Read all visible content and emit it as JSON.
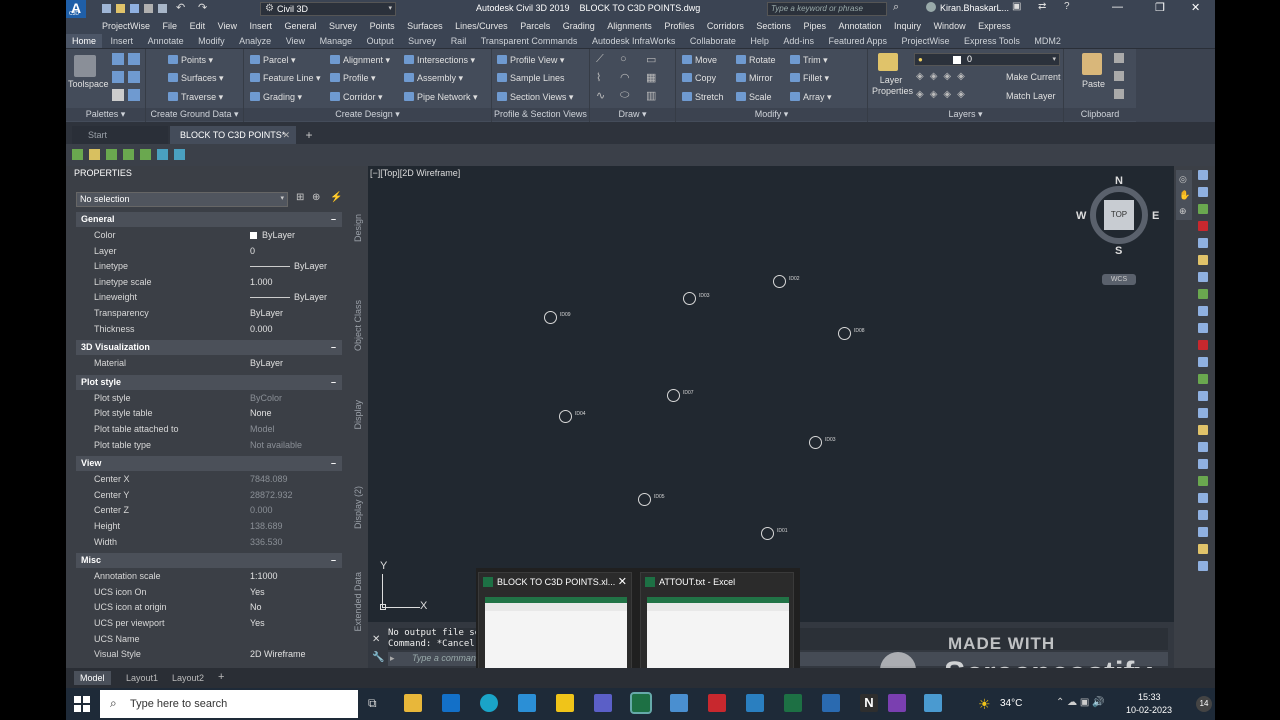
{
  "app": {
    "logo": "A",
    "logo_sub": "C3D",
    "workspace": "Civil 3D",
    "title": "Autodesk Civil 3D 2019    BLOCK TO C3D POINTS.dwg",
    "search_placeholder": "Type a keyword or phrase",
    "user": "Kiran.BhaskarL...",
    "min": "—",
    "max": "❐",
    "close": "✕"
  },
  "menu": [
    "ProjectWise",
    "File",
    "Edit",
    "View",
    "Insert",
    "General",
    "Survey",
    "Points",
    "Surfaces",
    "Lines/Curves",
    "Parcels",
    "Grading",
    "Alignments",
    "Profiles",
    "Corridors",
    "Sections",
    "Pipes",
    "Annotation",
    "Inquiry",
    "Window",
    "Express"
  ],
  "ribbon_tabs": [
    "Home",
    "Insert",
    "Annotate",
    "Modify",
    "Analyze",
    "View",
    "Manage",
    "Output",
    "Survey",
    "Rail",
    "Transparent Commands",
    "Autodesk InfraWorks",
    "Collaborate",
    "Help",
    "Add-ins",
    "Featured Apps",
    "ProjectWise",
    "Express Tools",
    "MDM2"
  ],
  "ribbon": {
    "toolspace": "Toolspace",
    "palettes": "Palettes ▾",
    "ground": [
      "Points ▾",
      "Surfaces ▾",
      "Traverse ▾"
    ],
    "ground_label": "Create Ground Data ▾",
    "design_col1": [
      "Parcel ▾",
      "Feature Line ▾",
      "Grading ▾"
    ],
    "design_col2": [
      "Alignment ▾",
      "Profile ▾",
      "Corridor ▾"
    ],
    "design_col3": [
      "Intersections ▾",
      "Assembly ▾",
      "Pipe Network ▾"
    ],
    "design_label": "Create Design ▾",
    "profile": [
      "Profile View ▾",
      "Sample Lines",
      "Section Views ▾"
    ],
    "profile_label": "Profile & Section Views",
    "draw_label": "Draw ▾",
    "modify_col1": [
      "Move",
      "Copy",
      "Stretch"
    ],
    "modify_col2": [
      "Rotate",
      "Mirror",
      "Scale"
    ],
    "modify_col3": [
      "Trim ▾",
      "Fillet ▾",
      "Array ▾"
    ],
    "modify_label": "Modify ▾",
    "layer_props": "Layer Properties",
    "layer_value": "0",
    "layer_cmds": [
      "Make Current",
      "Match Layer"
    ],
    "layers_label": "Layers ▾",
    "paste": "Paste",
    "clipboard_label": "Clipboard"
  },
  "doctabs": [
    "Start",
    "BLOCK TO C3D POINTS*"
  ],
  "doctab_add": "+",
  "properties": {
    "title": "PROPERTIES",
    "selection": "No selection",
    "sections": [
      {
        "name": "General",
        "rows": [
          [
            "Color",
            "ByLayer"
          ],
          [
            "Layer",
            "0"
          ],
          [
            "Linetype",
            "ByLayer"
          ],
          [
            "Linetype scale",
            "1.000"
          ],
          [
            "Lineweight",
            "ByLayer"
          ],
          [
            "Transparency",
            "ByLayer"
          ],
          [
            "Thickness",
            "0.000"
          ]
        ]
      },
      {
        "name": "3D Visualization",
        "rows": [
          [
            "Material",
            "ByLayer"
          ]
        ]
      },
      {
        "name": "Plot style",
        "rows": [
          [
            "Plot style",
            "ByColor"
          ],
          [
            "Plot style table",
            "None"
          ],
          [
            "Plot table attached to",
            "Model"
          ],
          [
            "Plot table type",
            "Not available"
          ]
        ]
      },
      {
        "name": "View",
        "rows": [
          [
            "Center X",
            "7848.089"
          ],
          [
            "Center Y",
            "28872.932"
          ],
          [
            "Center Z",
            "0.000"
          ],
          [
            "Height",
            "138.689"
          ],
          [
            "Width",
            "336.530"
          ]
        ]
      },
      {
        "name": "Misc",
        "rows": [
          [
            "Annotation scale",
            "1:1000"
          ],
          [
            "UCS icon On",
            "Yes"
          ],
          [
            "UCS icon at origin",
            "No"
          ],
          [
            "UCS per viewport",
            "Yes"
          ],
          [
            "UCS Name",
            ""
          ],
          [
            "Visual Style",
            "2D Wireframe"
          ]
        ]
      }
    ],
    "collapse": "–"
  },
  "sidetabs": [
    "Design",
    "Object Class",
    "Display",
    "Display (2)",
    "Extended Data"
  ],
  "viewport": {
    "label": "[−][Top][2D Wireframe]",
    "compass": {
      "n": "N",
      "s": "S",
      "e": "E",
      "w": "W",
      "top": "TOP",
      "wcs": "WCS"
    },
    "points": [
      "ID02",
      "ID03",
      "ID09",
      "ID08",
      "ID07",
      "ID04",
      "ID03",
      "ID05",
      "ID01"
    ],
    "ucs_x": "X",
    "ucs_y": "Y"
  },
  "cmd": {
    "line1": "No output file se",
    "line2": "Command: *Cancel",
    "placeholder": "Type a command"
  },
  "watermark": {
    "line1": "MADE WITH",
    "line2": "Screencastify"
  },
  "thumbs": [
    {
      "title": "BLOCK TO C3D POINTS.xl..."
    },
    {
      "title": "ATTOUT.txt - Excel"
    }
  ],
  "layouts": [
    "Model",
    "Layout1",
    "Layout2"
  ],
  "layout_add": "+",
  "taskbar": {
    "search": "Type here to search",
    "temp": "34°C",
    "time": "15:33",
    "date": "10-02-2023",
    "notif": "14"
  }
}
